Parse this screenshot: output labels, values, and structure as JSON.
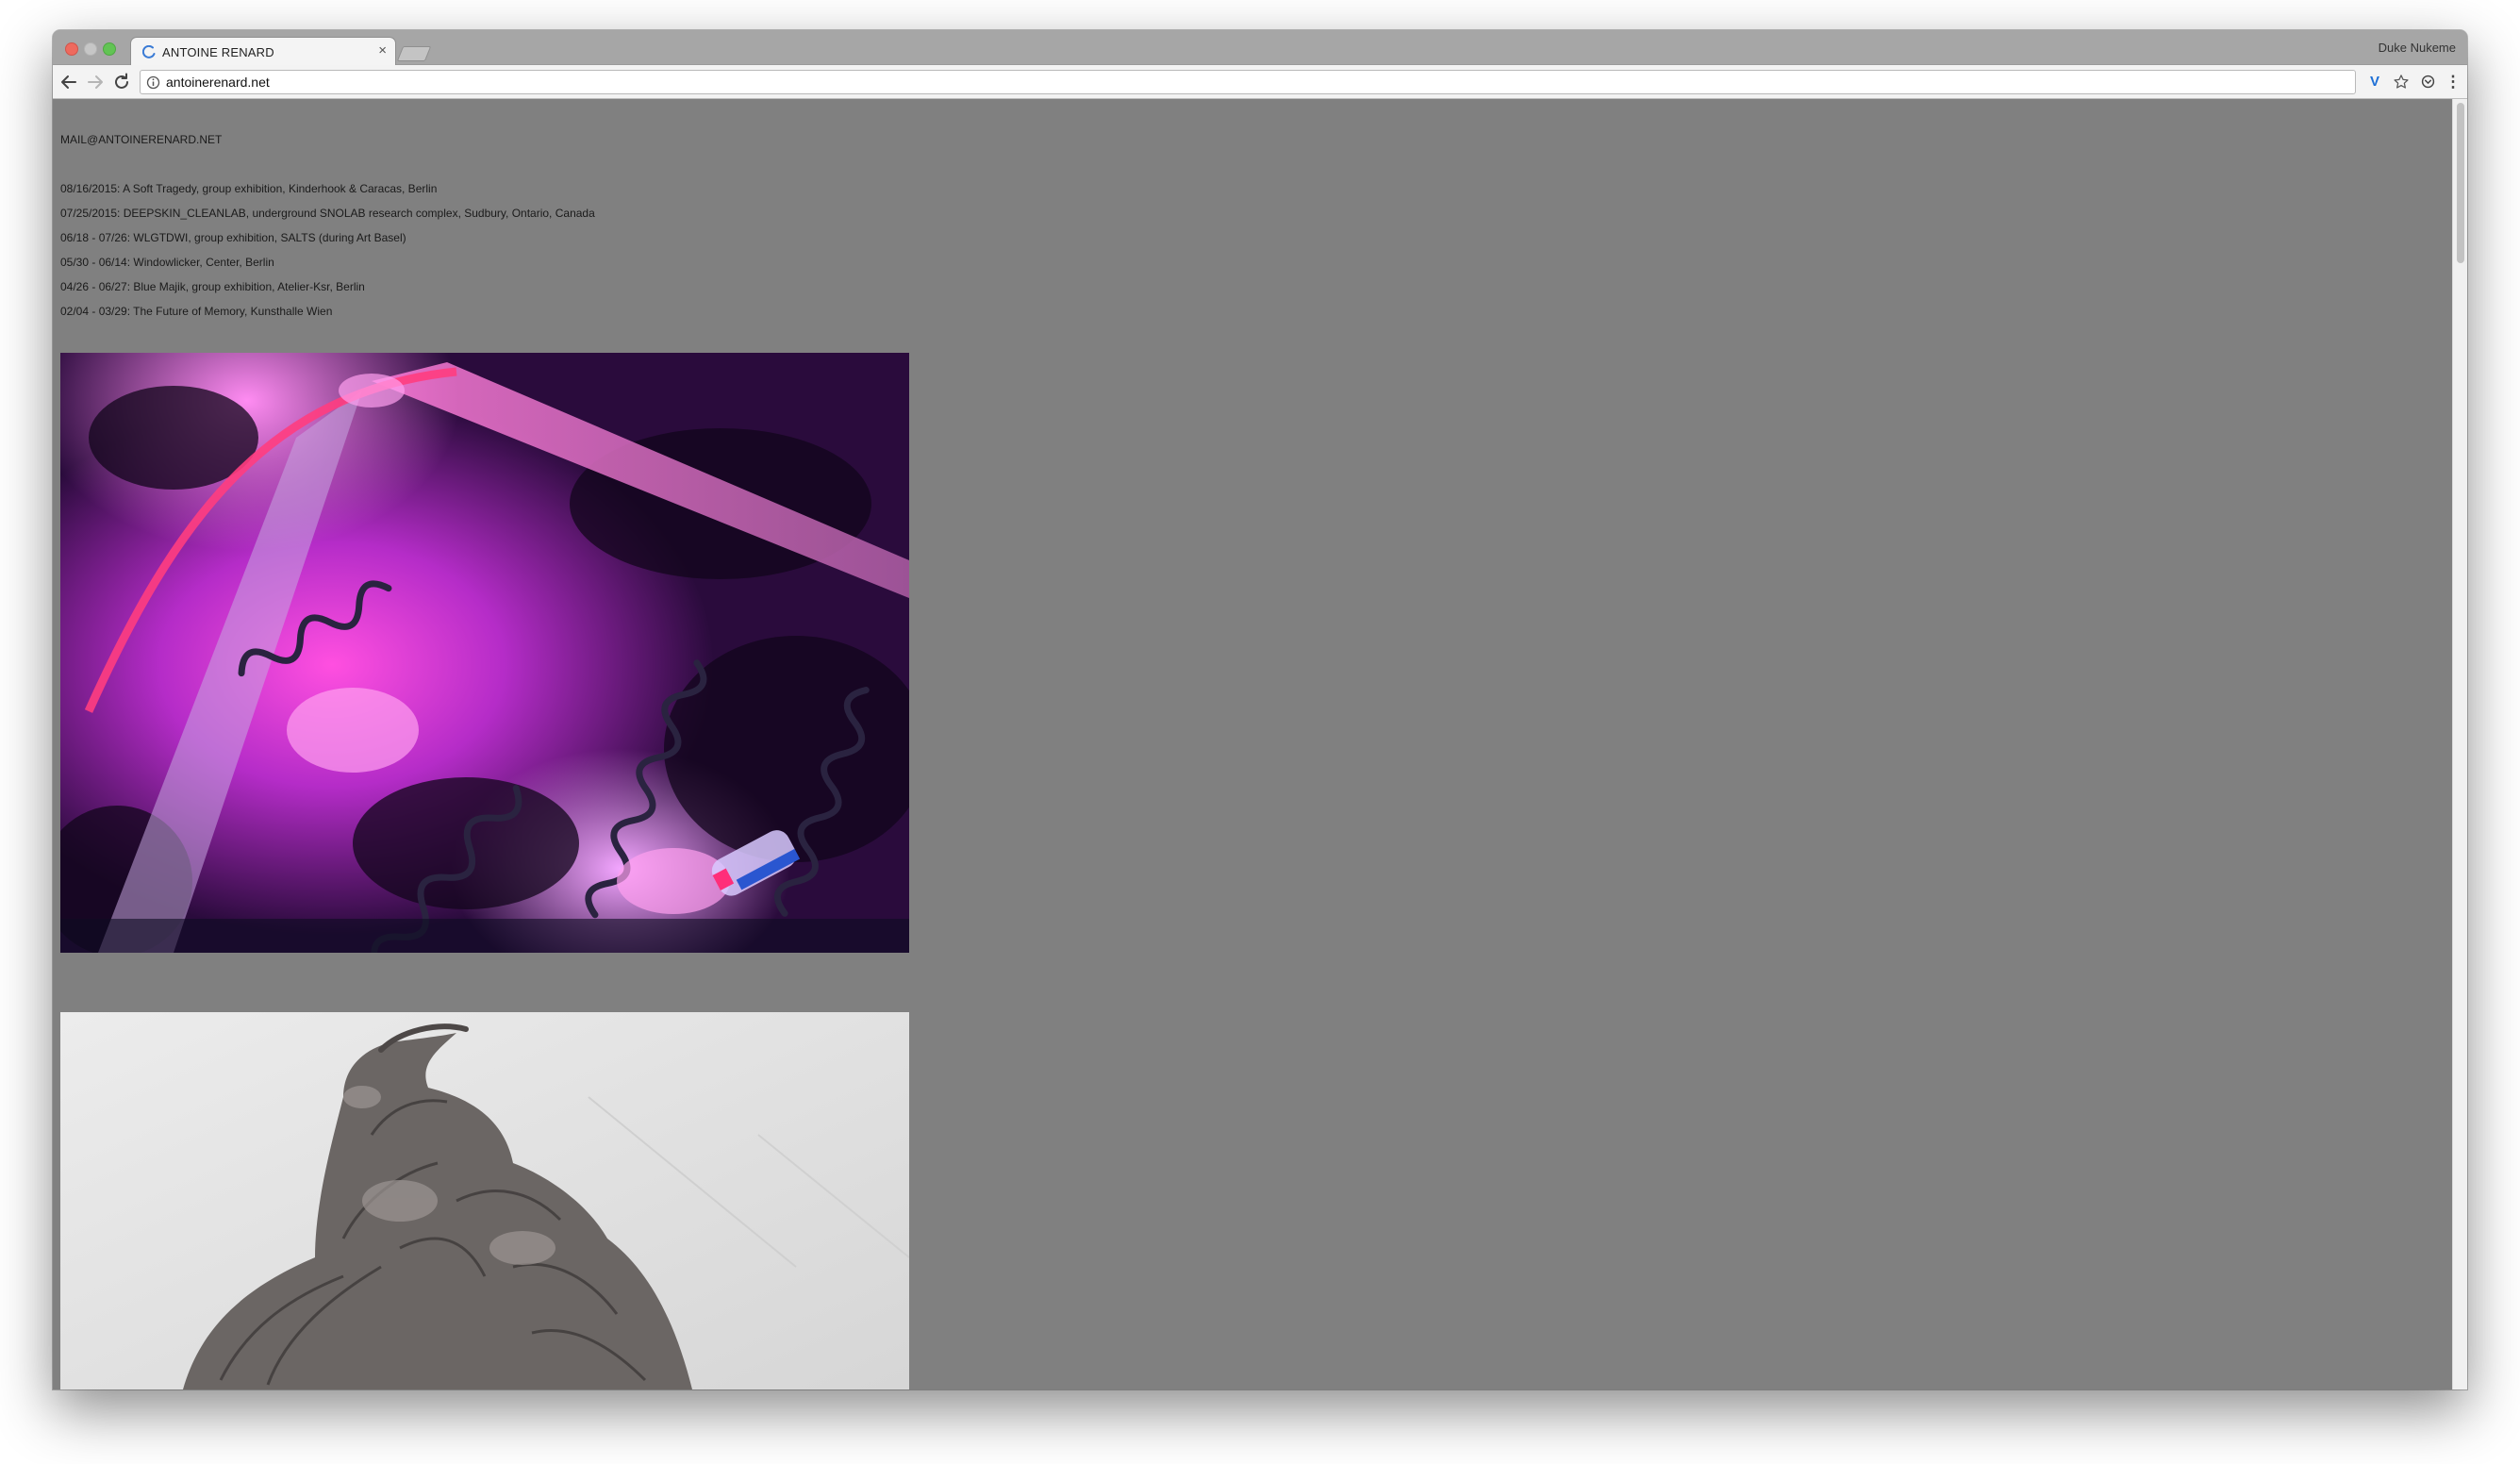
{
  "browser": {
    "tab_title": "ANTOINE RENARD",
    "tab_close": "×",
    "profile_name": "Duke Nukeme",
    "url": "antoinerenard.net",
    "icons": [
      "back-arrow-icon",
      "forward-arrow-icon",
      "reload-icon",
      "info-icon",
      "vimium-v-icon",
      "bookmark-star-icon",
      "pocket-icon",
      "kebab-menu-icon"
    ],
    "ext_v_label": "V",
    "menu_label": "⋮"
  },
  "page": {
    "contact": "MAIL@ANTOINERENARD.NET",
    "shows": [
      "08/16/2015: A Soft Tragedy, group exhibition, Kinderhook & Caracas, Berlin",
      "07/25/2015: DEEPSKIN_CLEANLAB, underground SNOLAB research complex, Sudbury, Ontario, Canada",
      "06/18 - 07/26: WLGTDWI, group exhibition, SALTS (during Art Basel)",
      "05/30 - 06/14: Windowlicker, Center, Berlin",
      "04/26 - 06/27: Blue Majik, group exhibition, Atelier-Ksr, Berlin",
      "02/04 - 03/29: The Future of Memory, Kunsthalle Wien"
    ]
  },
  "colors": {
    "page_background": "#808080",
    "accent_magenta": "#d23be0",
    "accent_violet": "#5a22a8",
    "sculpture_gray": "#6b6664"
  }
}
